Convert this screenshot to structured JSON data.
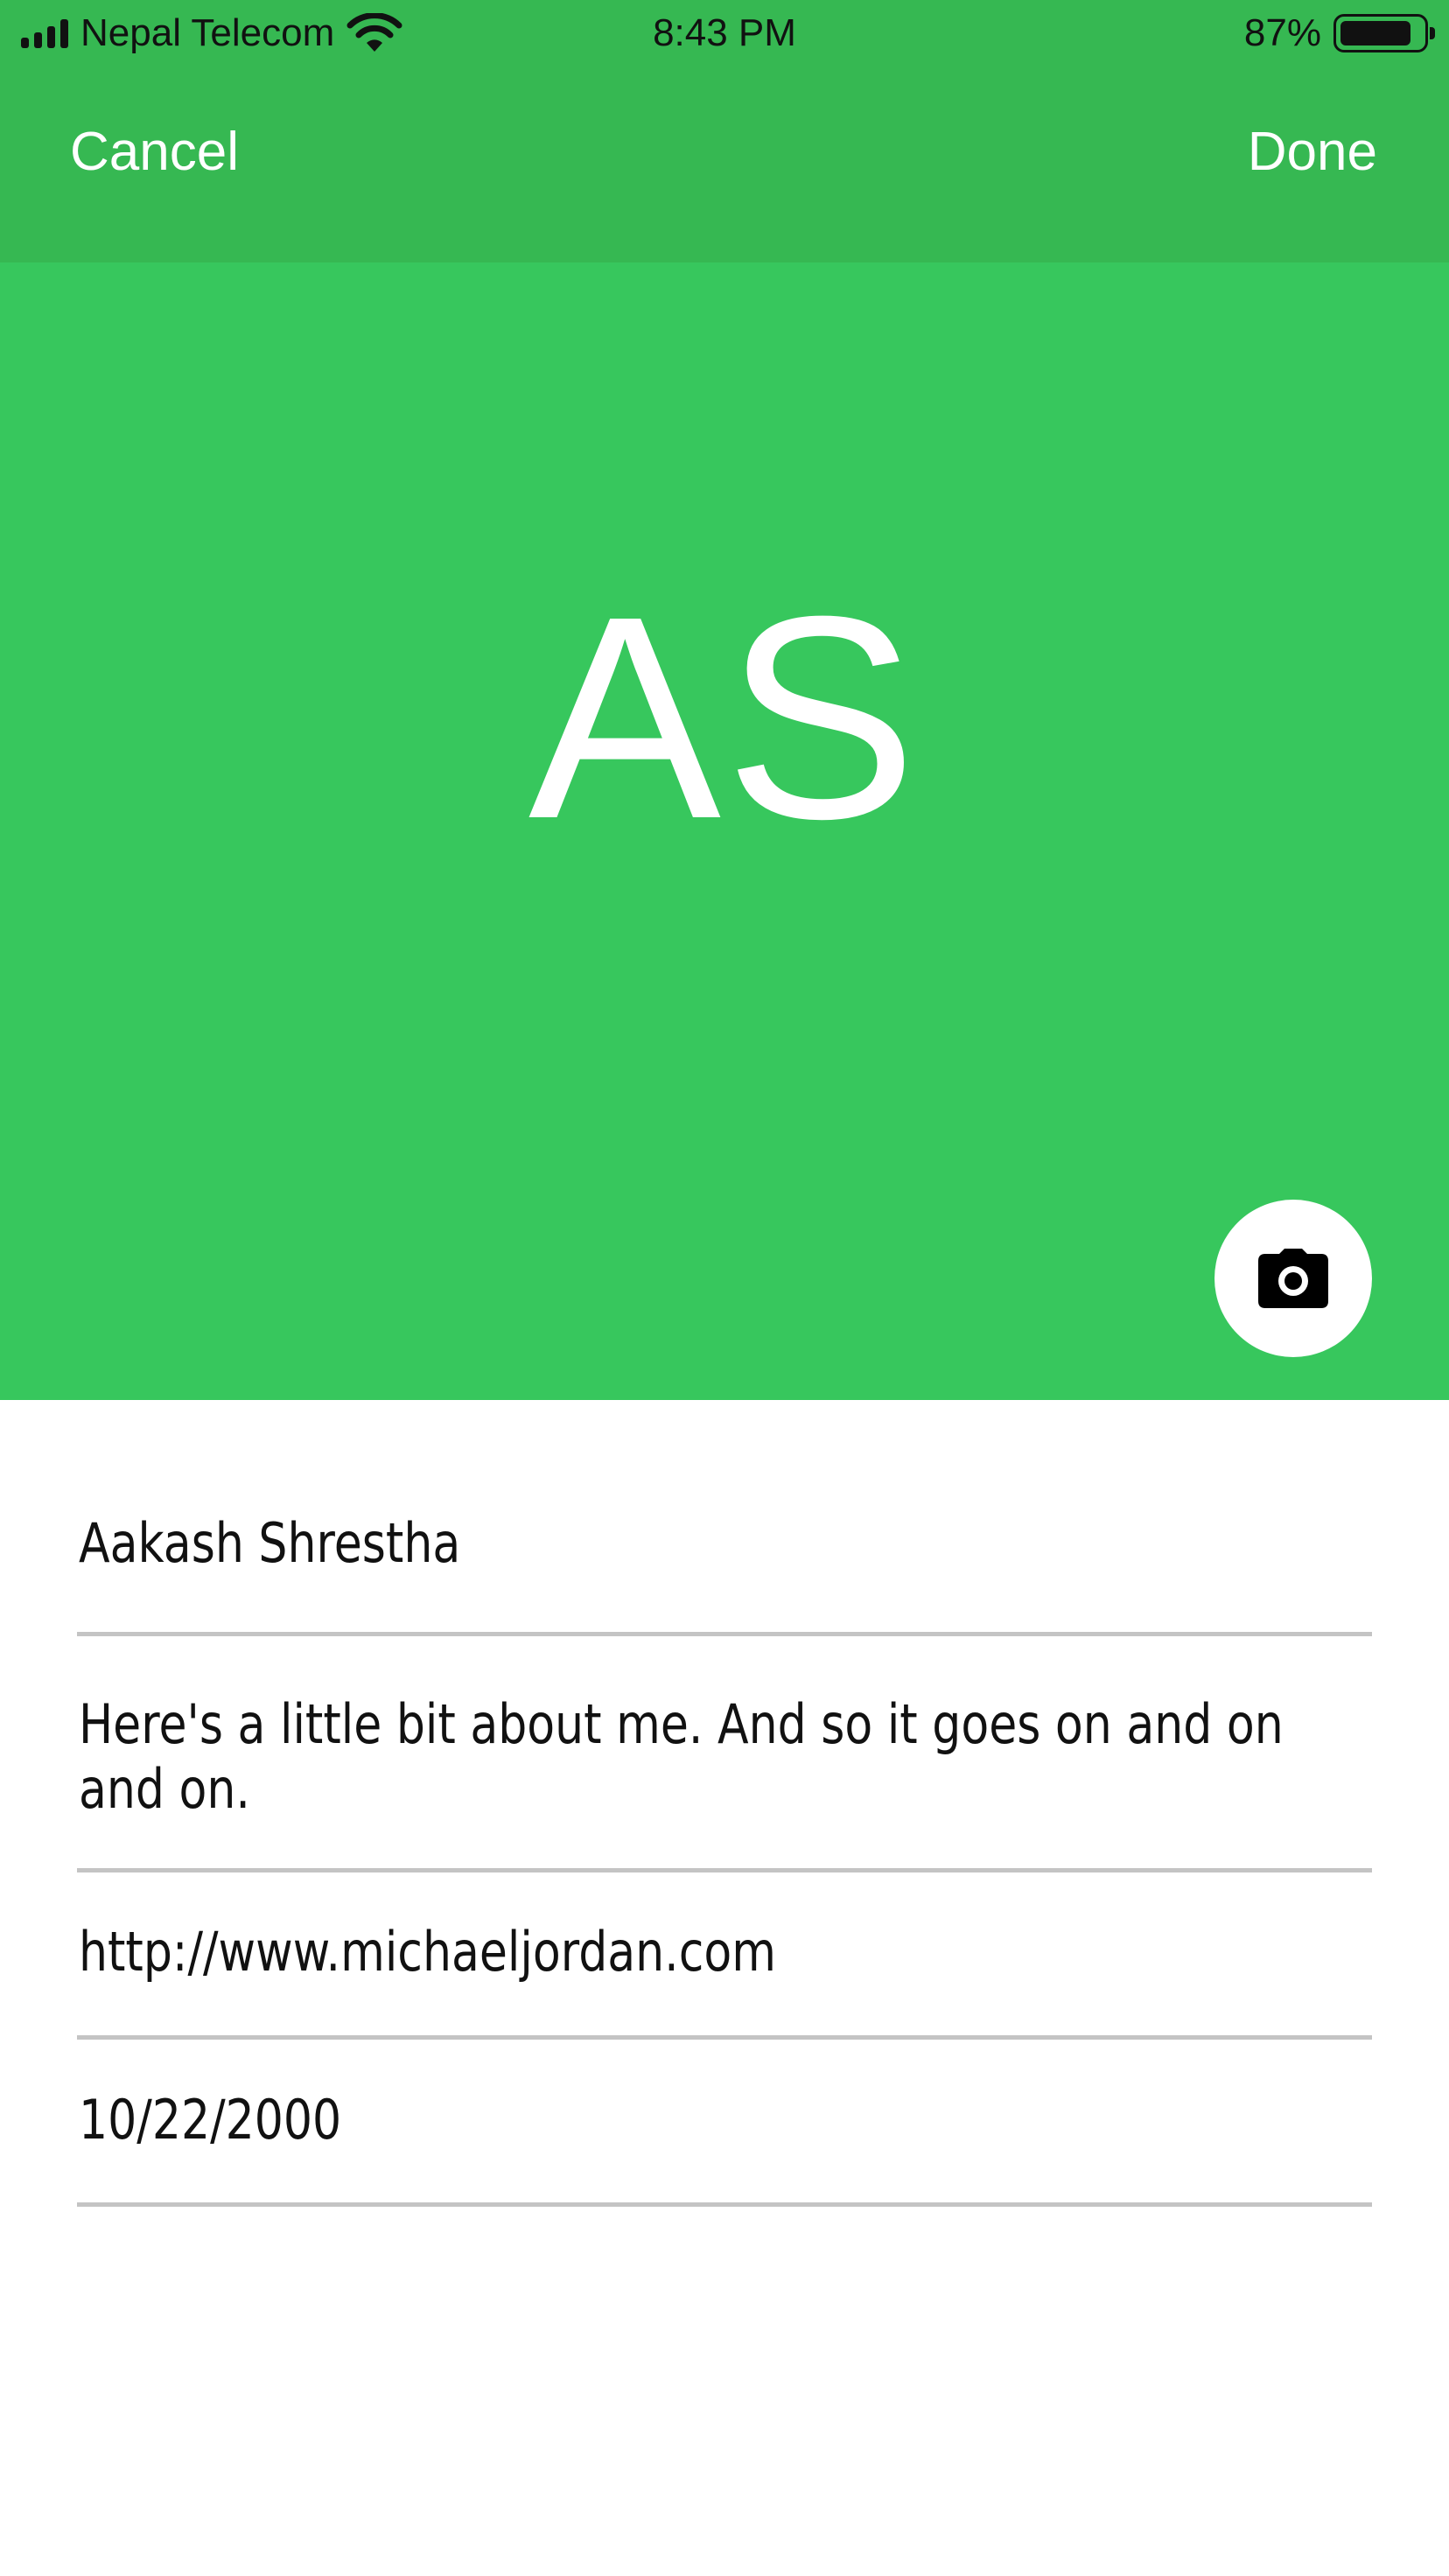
{
  "status_bar": {
    "carrier": "Nepal Telecom",
    "time": "8:43 PM",
    "battery_percent_label": "87%",
    "battery_level": 0.87,
    "signal_icon": "cellular-signal-icon",
    "wifi_icon": "wifi-icon",
    "battery_icon": "battery-icon"
  },
  "nav": {
    "cancel_label": "Cancel",
    "done_label": "Done"
  },
  "profile": {
    "initials": "AS",
    "camera_icon": "camera-icon"
  },
  "form": {
    "name": "Aakash Shrestha",
    "bio": "Here's a little bit about me. And so it goes on and on and on.",
    "website": "http://www.michaeljordan.com",
    "birthday": "10/22/2000"
  },
  "colors": {
    "nav_green": "#36b852",
    "header_green": "#37c75d",
    "divider_gray": "#c4c4c4"
  }
}
